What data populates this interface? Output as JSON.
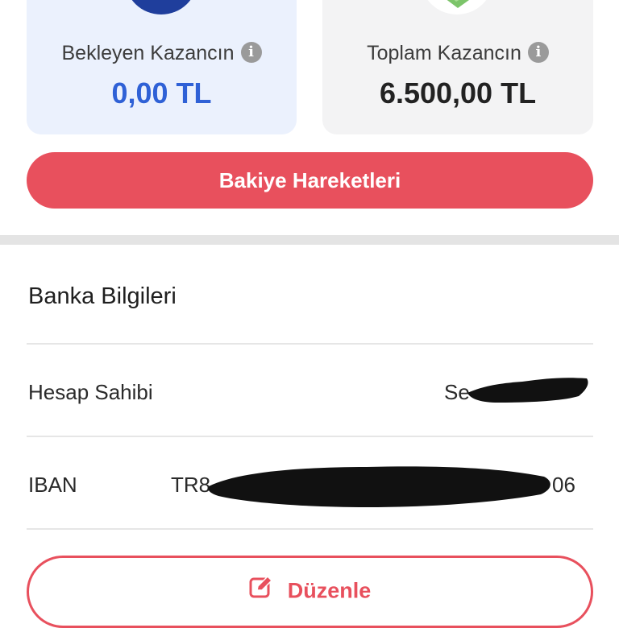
{
  "balance": {
    "pending": {
      "label": "Bekleyen Kazancın",
      "value": "0,00 TL"
    },
    "total": {
      "label": "Toplam Kazancın",
      "value": "6.500,00 TL"
    }
  },
  "actions": {
    "balance_movements": "Bakiye Hareketleri"
  },
  "bank": {
    "title": "Banka Bilgileri",
    "account_holder_label": "Hesap Sahibi",
    "account_holder_value": "Se",
    "iban_label": "IBAN",
    "iban_prefix": "TR8",
    "iban_suffix": "06",
    "edit_label": "Düzenle"
  },
  "colors": {
    "accent": "#e8505d",
    "pending_value": "#2f61d6",
    "pending_card": "#ebf1fd",
    "total_card": "#f3f3f4"
  }
}
